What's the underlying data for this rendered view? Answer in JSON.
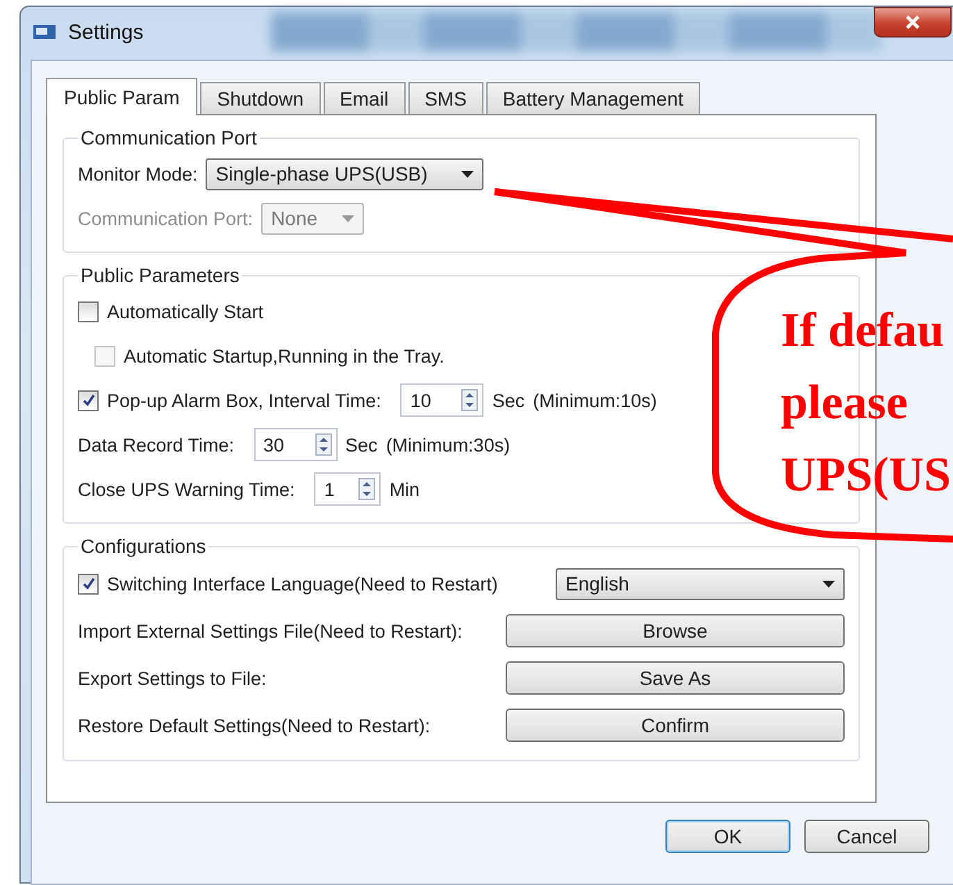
{
  "window": {
    "title": "Settings"
  },
  "tabs": [
    {
      "label": "Public Param",
      "selected": true
    },
    {
      "label": "Shutdown",
      "selected": false
    },
    {
      "label": "Email",
      "selected": false
    },
    {
      "label": "SMS",
      "selected": false
    },
    {
      "label": "Battery Management",
      "selected": false
    }
  ],
  "communication_port": {
    "title": "Communication Port",
    "fields": [
      {
        "label": "Monitor Mode:",
        "value": "Single-phase UPS(USB)",
        "disabled": false
      },
      {
        "label": "Communication Port:",
        "value": "None",
        "disabled": true
      }
    ]
  },
  "public_parameters": {
    "title": "Public Parameters",
    "rows": [
      {
        "kind": "checkbox",
        "label": "Automatically Start",
        "checked": false,
        "children": [
          {
            "kind": "checkbox",
            "label": "Automatic Startup,Running in the Tray.",
            "checked": false,
            "disabled": true
          }
        ]
      },
      {
        "kind": "checkbox-spinner",
        "label": "Pop-up Alarm Box, Interval Time:",
        "checked": true,
        "value": "10",
        "unit": "Sec",
        "note": "(Minimum:10s)"
      },
      {
        "kind": "spinner",
        "label": "Data Record Time:",
        "value": "30",
        "unit": "Sec",
        "note": "(Minimum:30s)"
      },
      {
        "kind": "spinner",
        "label": "Close UPS Warning Time:",
        "value": "1",
        "unit": "Min"
      }
    ]
  },
  "configurations": {
    "title": "Configurations",
    "rows": [
      {
        "kind": "checkbox-dropdown",
        "label": "Switching Interface Language(Need to Restart)",
        "checked": true,
        "value": "English"
      },
      {
        "kind": "button",
        "label": "Import External Settings File(Need to Restart):",
        "button": "Browse"
      },
      {
        "kind": "button",
        "label": "Export Settings to File:",
        "button": "Save As"
      },
      {
        "kind": "button",
        "label": "Restore Default Settings(Need to Restart):",
        "button": "Confirm"
      }
    ]
  },
  "buttons": [
    {
      "label": "OK",
      "default": true
    },
    {
      "label": "Cancel",
      "default": false
    }
  ],
  "annotation": {
    "lines": [
      "If defau",
      "please",
      "UPS(US"
    ]
  }
}
